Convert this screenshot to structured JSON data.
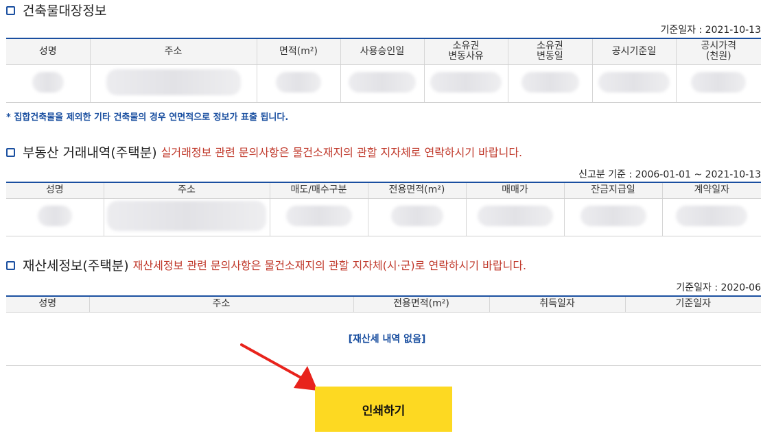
{
  "building": {
    "title": "건축물대장정보",
    "date_note": "기준일자 : 2021-10-13",
    "columns": [
      "성명",
      "주소",
      "면적(m²)",
      "사용승인일",
      "소유권\n변동사유",
      "소유권\n변동일",
      "공시기준일",
      "공시가격\n(천원)"
    ],
    "footnote": "* 집합건축물을 제외한 기타 건축물의 경우 연면적으로 정보가 표출 됩니다."
  },
  "transactions": {
    "title": "부동산 거래내역(주택분)",
    "note": "실거래정보 관련 문의사항은 물건소재지의 관할 지자체로 연락하시기 바랍니다.",
    "date_note": "신고분 기준 : 2006-01-01 ~ 2021-10-13",
    "columns": [
      "성명",
      "주소",
      "매도/매수구분",
      "전용면적(m²)",
      "매매가",
      "잔금지급일",
      "계약일자"
    ]
  },
  "property_tax": {
    "title": "재산세정보(주택분)",
    "note": "재산세정보 관련 문의사항은 물건소재지의 관할 지자체(시·군)로 연락하시기 바랍니다.",
    "date_note": "기준일자 : 2020-06",
    "columns": [
      "성명",
      "주소",
      "전용면적(m²)",
      "취득일자",
      "기준일자"
    ],
    "empty_message": "[재산세 내역 없음]"
  },
  "print_button_label": "인쇄하기",
  "colors": {
    "accent_blue": "#1a4fa0",
    "notice_red": "#c0392b",
    "button_yellow": "#fdd922",
    "arrow_red": "#e8231c"
  },
  "icons": [
    "square-bullet-icon",
    "pointer-arrow-icon"
  ]
}
